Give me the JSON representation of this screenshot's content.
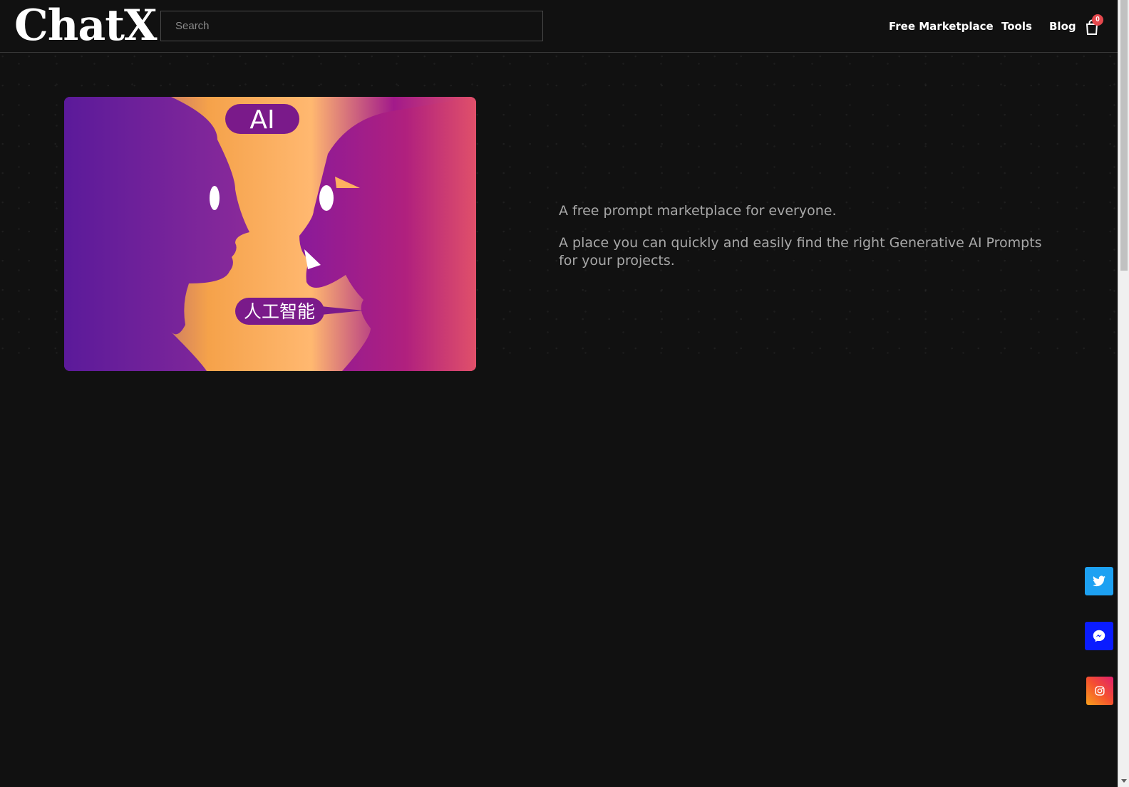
{
  "header": {
    "logo": "ChatX",
    "search_placeholder": "Search",
    "nav": {
      "marketplace": "Free Marketplace",
      "tools": "Tools",
      "blog": "Blog"
    },
    "cart_count": "0"
  },
  "hero": {
    "image_label_top": "AI",
    "image_label_bottom": "人工智能",
    "text_1": "A free prompt marketplace for everyone.",
    "text_2": "A place you can quickly and easily find the right Generative AI Prompts for your projects."
  },
  "social": {
    "twitter_icon": "twitter-icon",
    "messenger_icon": "messenger-icon",
    "instagram_icon": "instagram-icon"
  },
  "colors": {
    "background": "#111111",
    "twitter": "#1da1f2",
    "messenger": "#0a1cff",
    "badge": "#e5484d"
  }
}
